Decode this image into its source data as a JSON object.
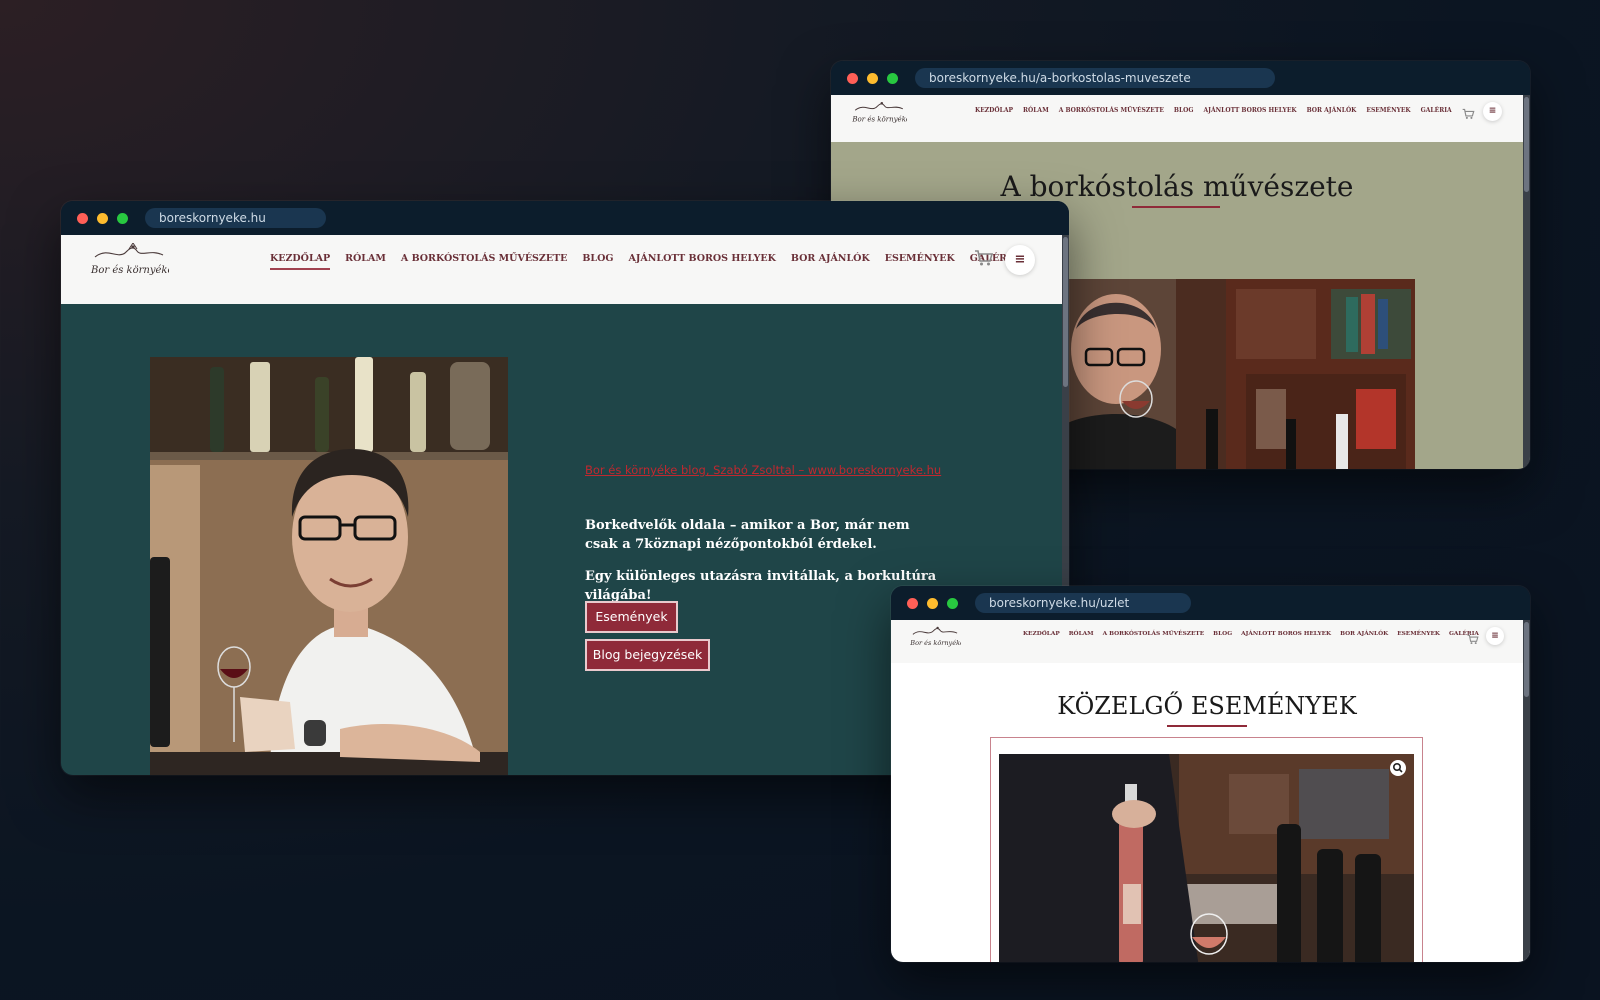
{
  "colors": {
    "brand_wine": "#8f2a39",
    "hero_bg": "#1f4548",
    "link_red": "#c0282f",
    "nav_text": "#6a3038"
  },
  "logo_text": "Bor és környéke",
  "nav_items": [
    "KEZDŐLAP",
    "RÓLAM",
    "A BORKÓSTOLÁS MŰVÉSZETE",
    "BLOG",
    "AJÁNLOTT BOROS HELYEK",
    "BOR AJÁNLÓK",
    "ESEMÉNYEK",
    "GALÉRIA"
  ],
  "icons": {
    "cart": "cart-icon",
    "menu": "hamburger-menu-icon"
  },
  "windows": {
    "main": {
      "url": "boreskornyeke.hu",
      "active_nav": "KEZDŐLAP",
      "hero": {
        "link": "Bor és környéke blog, Szabó Zsolttal – www.boreskornyeke.hu",
        "text1": "Borkedvelők oldala – amikor a Bor, már nem csak a 7köznapi nézőpontokból érdekel.",
        "text2": "Egy különleges utazásra invitállak, a borkultúra világába!",
        "button_events": "Események",
        "button_blog": "Blog bejegyzések"
      }
    },
    "top_right": {
      "url": "boreskornyeke.hu/a-borkostolas-muveszete",
      "title": "A borkóstolás művészete"
    },
    "bottom_right": {
      "url": "boreskornyeke.hu/uzlet",
      "title": "KÖZELGŐ ESEMÉNYEK"
    }
  }
}
